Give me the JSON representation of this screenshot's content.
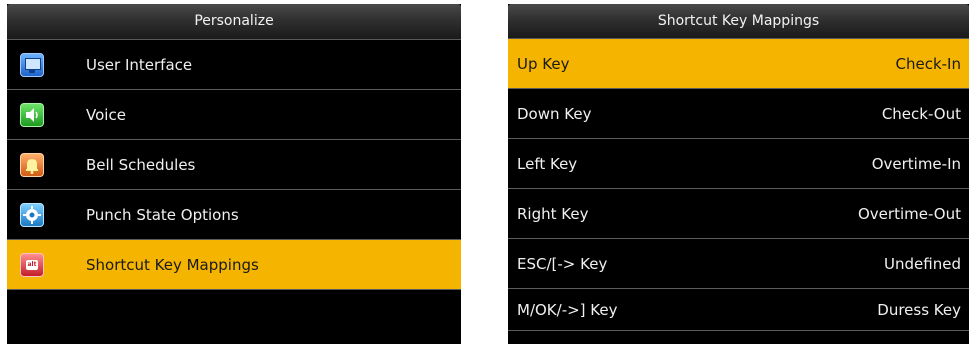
{
  "personalize": {
    "title": "Personalize",
    "items": [
      {
        "label": "User Interface",
        "icon": "monitor-icon"
      },
      {
        "label": "Voice",
        "icon": "speaker-icon"
      },
      {
        "label": "Bell Schedules",
        "icon": "bell-icon"
      },
      {
        "label": "Punch State Options",
        "icon": "gear-icon"
      },
      {
        "label": "Shortcut Key Mappings",
        "icon": "keyboard-key-icon",
        "selected": true
      }
    ]
  },
  "shortcut_mappings": {
    "title": "Shortcut Key Mappings",
    "rows": [
      {
        "key": "Up Key",
        "value": "Check-In",
        "selected": true
      },
      {
        "key": "Down Key",
        "value": "Check-Out"
      },
      {
        "key": "Left Key",
        "value": "Overtime-In"
      },
      {
        "key": "Right Key",
        "value": "Overtime-Out"
      },
      {
        "key": "ESC/[-> Key",
        "value": "Undefined"
      },
      {
        "key": "M/OK/->] Key",
        "value": "Duress Key"
      }
    ]
  },
  "colors": {
    "highlight": "#f4b400",
    "background": "#000000",
    "text": "#f0f0f0",
    "divider": "#5c5c5c"
  }
}
